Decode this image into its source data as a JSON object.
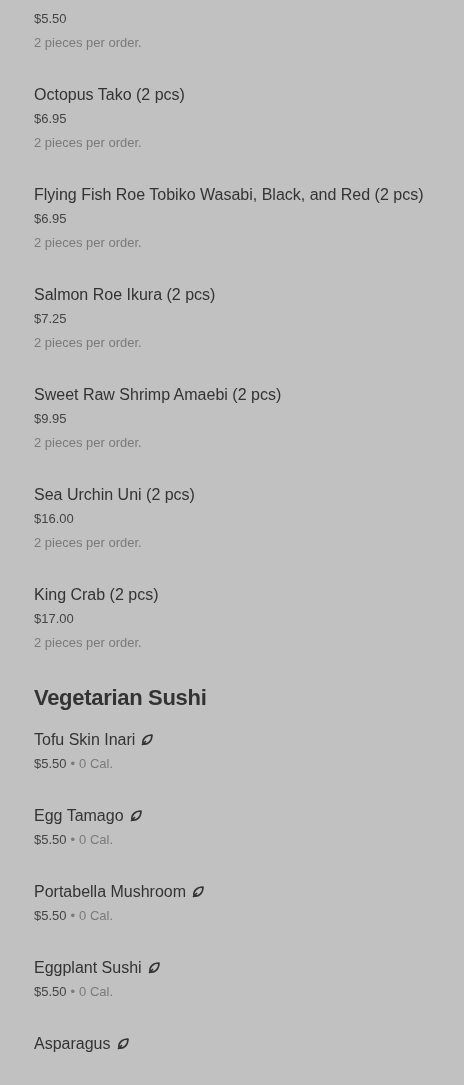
{
  "sections": [
    {
      "items": [
        {
          "price": "$5.50",
          "description": "2 pieces per order."
        },
        {
          "name": "Octopus Tako (2 pcs)",
          "price": "$6.95",
          "description": "2 pieces per order."
        },
        {
          "name": "Flying Fish Roe Tobiko Wasabi, Black, and Red (2 pcs)",
          "price": "$6.95",
          "description": "2 pieces per order."
        },
        {
          "name": "Salmon Roe Ikura (2 pcs)",
          "price": "$7.25",
          "description": "2 pieces per order."
        },
        {
          "name": "Sweet Raw Shrimp Amaebi (2 pcs)",
          "price": "$9.95",
          "description": "2 pieces per order."
        },
        {
          "name": "Sea Urchin Uni (2 pcs)",
          "price": "$16.00",
          "description": "2 pieces per order."
        },
        {
          "name": "King Crab (2 pcs)",
          "price": "$17.00",
          "description": "2 pieces per order."
        }
      ]
    },
    {
      "title": "Vegetarian Sushi",
      "items": [
        {
          "name": "Tofu Skin Inari",
          "vegetarian": true,
          "price": "$5.50",
          "separator": "•",
          "calories": "0 Cal."
        },
        {
          "name": "Egg Tamago",
          "vegetarian": true,
          "price": "$5.50",
          "separator": "•",
          "calories": "0 Cal."
        },
        {
          "name": "Portabella Mushroom",
          "vegetarian": true,
          "price": "$5.50",
          "separator": "•",
          "calories": "0 Cal."
        },
        {
          "name": "Eggplant Sushi",
          "vegetarian": true,
          "price": "$5.50",
          "separator": "•",
          "calories": "0 Cal."
        },
        {
          "name": "Asparagus",
          "vegetarian": true
        }
      ]
    }
  ]
}
